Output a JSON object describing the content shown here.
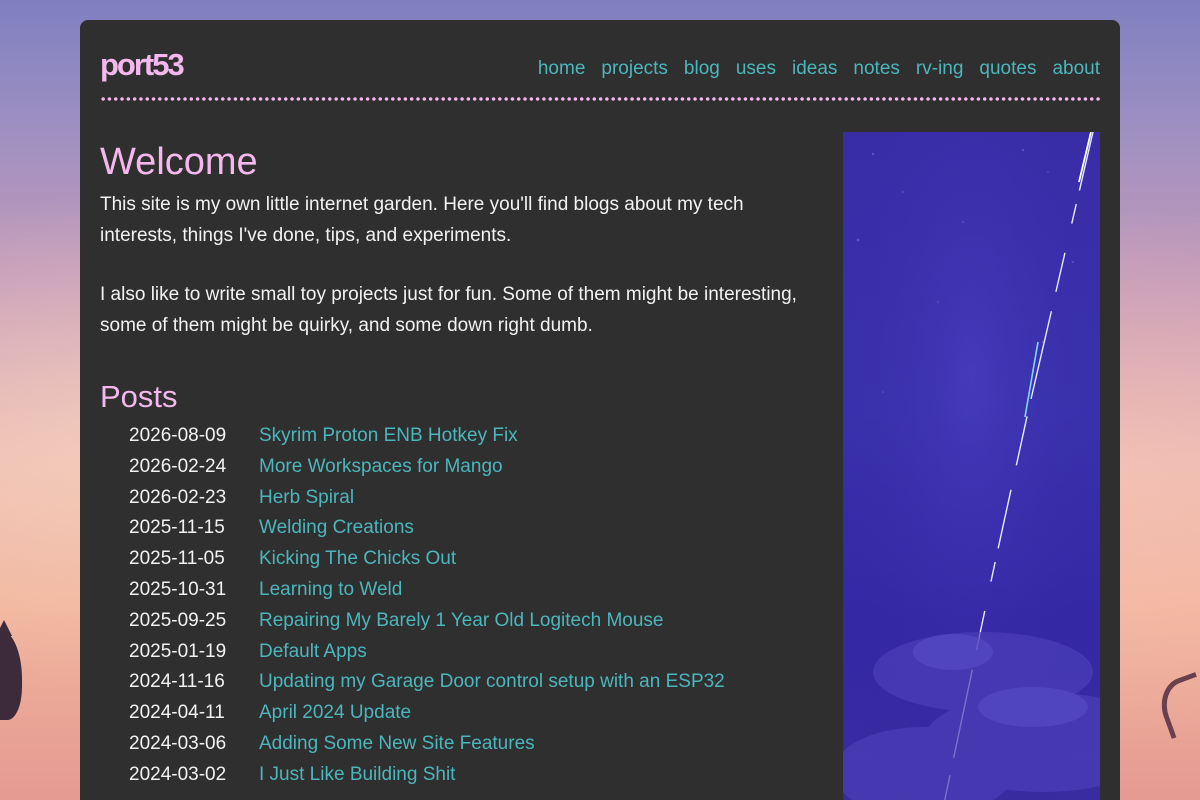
{
  "site": {
    "logo": "port53",
    "nav": [
      "home",
      "projects",
      "blog",
      "uses",
      "ideas",
      "notes",
      "rv-ing",
      "quotes",
      "about"
    ]
  },
  "main": {
    "welcome_heading": "Welcome",
    "paragraphs": [
      "This site is my own little internet garden. Here you'll find blogs about my tech interests, things I've done, tips, and experiments.",
      "I also like to write small toy projects just for fun. Some of them might be interesting, some of them might be quirky, and some down right dumb."
    ],
    "posts_heading": "Posts",
    "posts": [
      {
        "date": "2026-08-09",
        "title": "Skyrim Proton ENB Hotkey Fix"
      },
      {
        "date": "2026-02-24",
        "title": "More Workspaces for Mango"
      },
      {
        "date": "2026-02-23",
        "title": "Herb Spiral"
      },
      {
        "date": "2025-11-15",
        "title": "Welding Creations"
      },
      {
        "date": "2025-11-05",
        "title": "Kicking The Chicks Out"
      },
      {
        "date": "2025-10-31",
        "title": "Learning to Weld"
      },
      {
        "date": "2025-09-25",
        "title": "Repairing My Barely 1 Year Old Logitech Mouse"
      },
      {
        "date": "2025-01-19",
        "title": "Default Apps"
      },
      {
        "date": "2024-11-16",
        "title": "Updating my Garage Door control setup with an ESP32"
      },
      {
        "date": "2024-04-11",
        "title": "April 2024 Update"
      },
      {
        "date": "2024-03-06",
        "title": "Adding Some New Site Features"
      },
      {
        "date": "2024-03-02",
        "title": "I Just Like Building Shit"
      }
    ]
  },
  "colors": {
    "panel": "#2f2f2f",
    "accent_pink": "#f4b8ef",
    "link_teal": "#4cb6bd",
    "text": "#f2f2f2"
  }
}
